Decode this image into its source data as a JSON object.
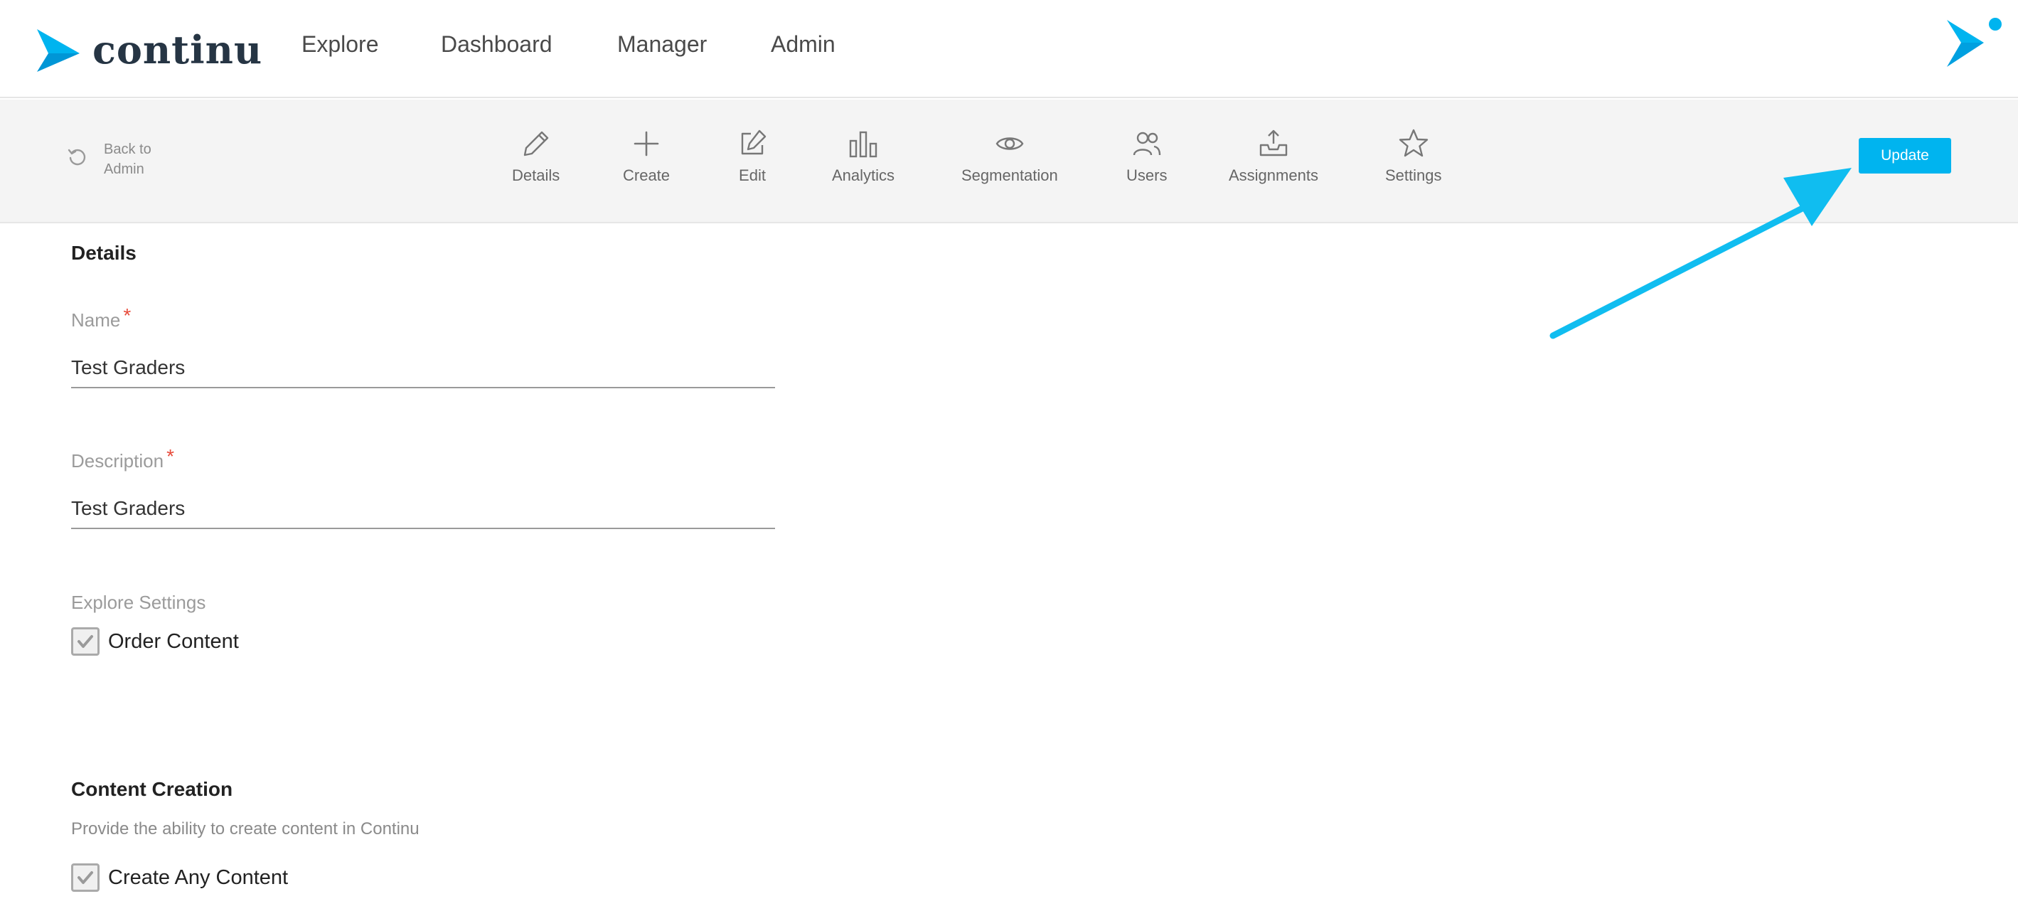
{
  "app": {
    "name": "continu"
  },
  "nav": {
    "items": [
      {
        "label": "Explore"
      },
      {
        "label": "Dashboard"
      },
      {
        "label": "Manager"
      },
      {
        "label": "Admin"
      }
    ]
  },
  "subbar": {
    "back_label": "Back to Admin",
    "tools": [
      {
        "label": "Details",
        "icon": "pencil-icon"
      },
      {
        "label": "Create",
        "icon": "plus-icon"
      },
      {
        "label": "Edit",
        "icon": "edit-icon"
      },
      {
        "label": "Analytics",
        "icon": "bar-chart-icon"
      },
      {
        "label": "Segmentation",
        "icon": "eye-icon"
      },
      {
        "label": "Users",
        "icon": "users-icon"
      },
      {
        "label": "Assignments",
        "icon": "inbox-upload-icon"
      },
      {
        "label": "Settings",
        "icon": "star-icon"
      }
    ],
    "update_label": "Update"
  },
  "form": {
    "details_title": "Details",
    "name": {
      "label": "Name",
      "required": "*",
      "value": "Test Graders"
    },
    "description": {
      "label": "Description",
      "required": "*",
      "value": "Test Graders"
    },
    "explore_settings": {
      "label": "Explore Settings",
      "order_content": {
        "label": "Order Content",
        "checked": true
      }
    },
    "content_creation": {
      "title": "Content Creation",
      "helper": "Provide the ability to create content in Continu",
      "create_any": {
        "label": "Create Any Content",
        "checked": true
      }
    }
  },
  "colors": {
    "brand": "#00b4ef",
    "logo_text": "#263544",
    "required": "#e74c3c"
  }
}
